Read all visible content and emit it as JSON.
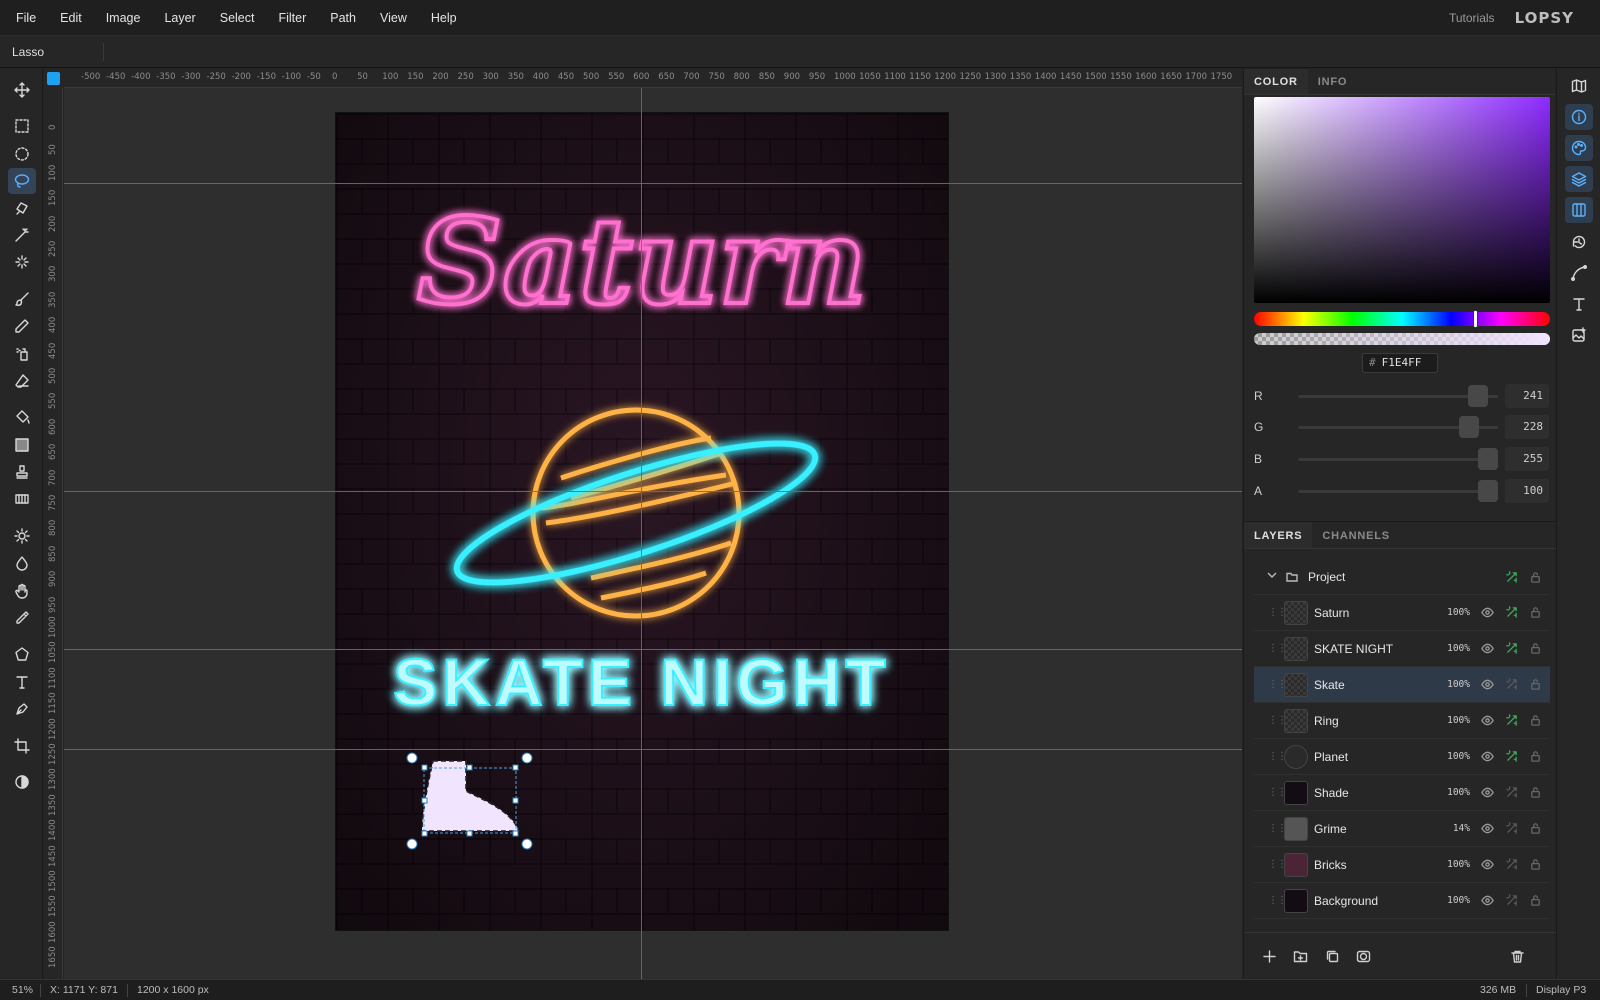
{
  "menu": {
    "items": [
      "File",
      "Edit",
      "Image",
      "Layer",
      "Select",
      "Filter",
      "Path",
      "View",
      "Help"
    ],
    "tutorials": "Tutorials",
    "logo": "LOPSY"
  },
  "options": {
    "tool_name": "Lasso"
  },
  "toolbar": {
    "tools": [
      {
        "name": "move-tool",
        "icon": "move-icon"
      },
      {
        "name": "rect-select-tool",
        "icon": "rect-select-icon"
      },
      {
        "name": "ellipse-select-tool",
        "icon": "ellipse-select-icon"
      },
      {
        "name": "lasso-tool",
        "icon": "lasso-icon",
        "active": true
      },
      {
        "name": "magnetic-lasso-tool",
        "icon": "magnetic-lasso-icon"
      },
      {
        "name": "magic-wand-tool",
        "icon": "magic-wand-icon"
      },
      {
        "name": "quick-select-tool",
        "icon": "sparkle-icon"
      },
      {
        "name": "brush-tool",
        "icon": "brush-icon"
      },
      {
        "name": "pencil-tool",
        "icon": "pencil-icon"
      },
      {
        "name": "spray-tool",
        "icon": "spray-icon"
      },
      {
        "name": "eraser-tool",
        "icon": "eraser-icon"
      },
      {
        "name": "fill-tool",
        "icon": "bucket-icon"
      },
      {
        "name": "gradient-tool",
        "icon": "gradient-icon"
      },
      {
        "name": "stamp-tool",
        "icon": "stamp-icon"
      },
      {
        "name": "pattern-tool",
        "icon": "pattern-icon"
      },
      {
        "name": "dodge-tool",
        "icon": "sun-icon"
      },
      {
        "name": "sharpen-tool",
        "icon": "drop-icon"
      },
      {
        "name": "smudge-tool",
        "icon": "hand-icon"
      },
      {
        "name": "eyedropper-tool",
        "icon": "eyedropper-icon"
      },
      {
        "name": "shape-tool",
        "icon": "pentagon-icon"
      },
      {
        "name": "text-tool",
        "icon": "text-icon"
      },
      {
        "name": "pen-tool",
        "icon": "pen-icon"
      },
      {
        "name": "crop-tool",
        "icon": "crop-icon"
      },
      {
        "name": "contrast-tool",
        "icon": "contrast-icon"
      }
    ]
  },
  "rulers": {
    "top": [
      "-500",
      "-450",
      "-400",
      "-350",
      "-300",
      "-250",
      "-200",
      "-150",
      "-100",
      "-50",
      "0",
      "50",
      "100",
      "150",
      "200",
      "250",
      "300",
      "350",
      "400",
      "450",
      "500",
      "550",
      "600",
      "650",
      "700",
      "750",
      "800",
      "850",
      "900",
      "950",
      "1000",
      "1050",
      "1100",
      "1150",
      "1200",
      "1250",
      "1300",
      "1350",
      "1400",
      "1450",
      "1500",
      "1550",
      "1600",
      "1650",
      "1700",
      "1750"
    ],
    "left": [
      "0",
      "50",
      "100",
      "150",
      "200",
      "250",
      "300",
      "350",
      "400",
      "450",
      "500",
      "550",
      "600",
      "650",
      "700",
      "750",
      "800",
      "850",
      "900",
      "950",
      "1000",
      "1050",
      "1100",
      "1150",
      "1200",
      "1250",
      "1300",
      "1350",
      "1400",
      "1450",
      "1500",
      "1550",
      "1600",
      "1650"
    ]
  },
  "canvas": {
    "title_neon": "Saturn",
    "subtitle_neon": "SKATE NIGHT",
    "brand_pink": "#ff5fc8",
    "brand_cyan": "#39f0ff",
    "brand_orange": "#ffb347"
  },
  "color_panel": {
    "tabs": [
      "COLOR",
      "INFO"
    ],
    "hex_prefix": "#",
    "hex": "F1E4FF",
    "hue_color": "#8d2bff",
    "channels": [
      {
        "label": "R",
        "value": "241",
        "fraction": 0.945
      },
      {
        "label": "G",
        "value": "228",
        "fraction": 0.894
      },
      {
        "label": "B",
        "value": "255",
        "fraction": 1.0
      },
      {
        "label": "A",
        "value": "100",
        "fraction": 1.0
      }
    ]
  },
  "layers_panel": {
    "tabs": [
      "LAYERS",
      "CHANNELS"
    ],
    "group": {
      "name": "Project"
    },
    "layers": [
      {
        "name": "Saturn",
        "opacity": "100%",
        "fx": true,
        "thumb": "checker"
      },
      {
        "name": "SKATE NIGHT",
        "opacity": "100%",
        "fx": true,
        "thumb": "checker"
      },
      {
        "name": "Skate",
        "opacity": "100%",
        "fx": false,
        "thumb": "checker",
        "selected": true
      },
      {
        "name": "Ring",
        "opacity": "100%",
        "fx": true,
        "thumb": "checker"
      },
      {
        "name": "Planet",
        "opacity": "100%",
        "fx": true,
        "thumb": "planet"
      },
      {
        "name": "Shade",
        "opacity": "100%",
        "fx": false,
        "thumb": "dark"
      },
      {
        "name": "Grime",
        "opacity": "14%",
        "fx": false,
        "thumb": "grime"
      },
      {
        "name": "Bricks",
        "opacity": "100%",
        "fx": false,
        "thumb": "bricks"
      },
      {
        "name": "Background",
        "opacity": "100%",
        "fx": false,
        "thumb": "dark"
      }
    ]
  },
  "status": {
    "zoom": "51%",
    "coords": "X: 1171  Y: 871",
    "doc_size": "1200 x 1600 px",
    "memory": "326 MB",
    "color_profile": "Display P3"
  }
}
